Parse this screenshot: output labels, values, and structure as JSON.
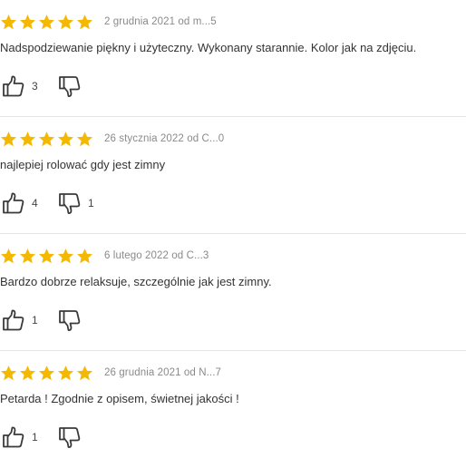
{
  "colors": {
    "star": "#f5b800",
    "icon": "#3a3a3a",
    "divider": "#e4e4e4"
  },
  "reviews": [
    {
      "rating": 5,
      "date": "2 grudnia 2021 od m...5",
      "text": "Nadspodziewanie piękny i użyteczny. Wykonany starannie. Kolor jak na zdjęciu.",
      "likes": "3",
      "dislikes": ""
    },
    {
      "rating": 5,
      "date": "26 stycznia 2022 od C...0",
      "text": "najlepiej rolować gdy jest zimny",
      "likes": "4",
      "dislikes": "1"
    },
    {
      "rating": 5,
      "date": "6 lutego 2022 od C...3",
      "text": "Bardzo dobrze relaksuje, szczególnie jak jest zimny.",
      "likes": "1",
      "dislikes": ""
    },
    {
      "rating": 5,
      "date": "26 grudnia 2021 od N...7",
      "text": "Petarda ! Zgodnie z opisem, świetnej jakości !",
      "likes": "1",
      "dislikes": ""
    }
  ]
}
